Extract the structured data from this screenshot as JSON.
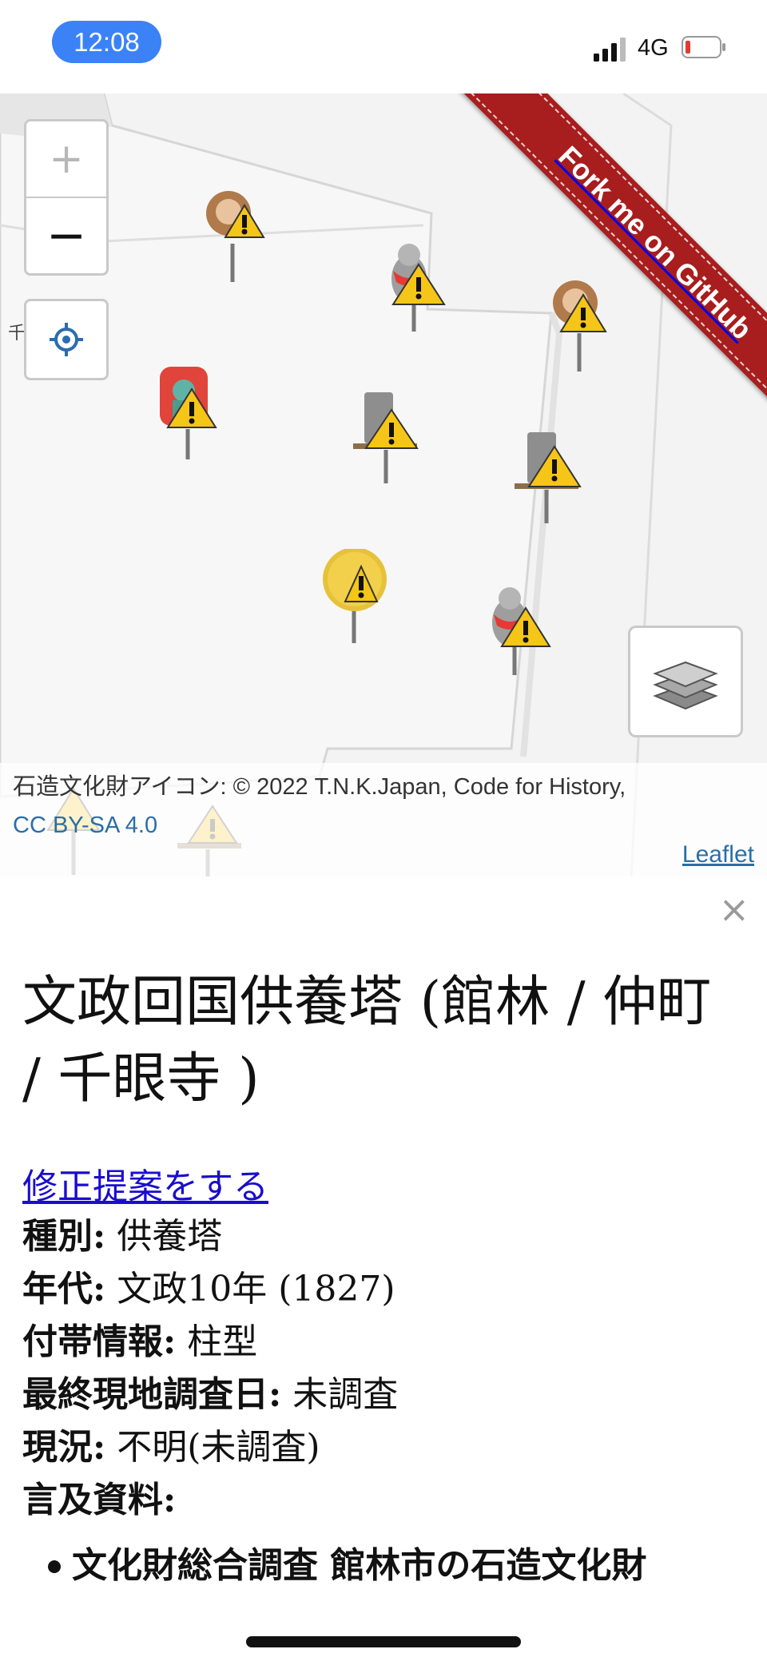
{
  "status_bar": {
    "time": "12:08",
    "network": "4G",
    "battery_color": "#e53935"
  },
  "map": {
    "zoom_in_label": "+",
    "zoom_out_label": "−",
    "ribbon_text": "Fork me on GitHub",
    "partial_label": "千",
    "attribution": "石造文化財アイコン: © 2022 T.N.K.Japan, Code for History,",
    "license_link": "CC BY-SA 4.0",
    "leaflet_link": "Leaflet",
    "marker_icons": [
      "monkey-icon",
      "jizo-icon",
      "monkey-icon",
      "fudo-myoo-icon",
      "gravestone-icon",
      "gravestone-icon",
      "moon-icon",
      "jizo-icon",
      "stone-icon",
      "gravestone-icon"
    ],
    "ribbon_color": "#a81d1d",
    "warning_color": "#f5c518"
  },
  "popup": {
    "close_label": "×",
    "title": "文政回国供養塔 (館林 / 仲町 / 千眼寺 )",
    "suggest_link": "修正提案をする",
    "fields": [
      {
        "label": "種別:",
        "value": "供養塔"
      },
      {
        "label": "年代:",
        "value": "文政10年 (1827)"
      },
      {
        "label": "付帯情報:",
        "value": "柱型"
      },
      {
        "label": "最終現地調査日:",
        "value": "未調査"
      },
      {
        "label": "現況:",
        "value": "不明(未調査)"
      },
      {
        "label": "言及資料:",
        "value": ""
      }
    ],
    "references": [
      "文化財総合調査 館林市の石造文化財"
    ]
  }
}
